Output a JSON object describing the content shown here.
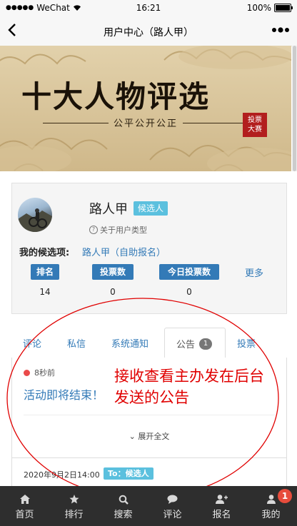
{
  "status_bar": {
    "carrier": "WeChat",
    "time": "16:21",
    "battery": "100%"
  },
  "nav": {
    "title": "用户中心（路人甲）"
  },
  "banner": {
    "title": "十大人物评选",
    "subtitle": "公平公开公正",
    "seal_line1": "投票",
    "seal_line2": "大赛"
  },
  "profile": {
    "name": "路人甲",
    "role_badge": "候选人",
    "user_type_link": "关于用户类型",
    "candidate_label": "我的候选项:",
    "candidate_value": "路人甲（自助报名）",
    "stats": [
      {
        "label": "排名",
        "value": "14"
      },
      {
        "label": "投票数",
        "value": "0"
      },
      {
        "label": "今日投票数",
        "value": "0"
      }
    ],
    "more_label": "更多"
  },
  "tabs": {
    "items": [
      "评论",
      "私信",
      "系统通知",
      "公告",
      "投票"
    ],
    "active_count": "1"
  },
  "notice": {
    "time": "8秒前",
    "message": "活动即将结束！",
    "expand_label": "展开全文",
    "date": "2020年9月2日14:00",
    "to_badge": "To：候选人"
  },
  "annotation": {
    "text": "接收查看主办发在后台发送的公告"
  },
  "tabbar": {
    "items": [
      {
        "label": "首页",
        "icon": "home-icon"
      },
      {
        "label": "排行",
        "icon": "star-icon"
      },
      {
        "label": "搜索",
        "icon": "search-icon"
      },
      {
        "label": "评论",
        "icon": "comment-icon"
      },
      {
        "label": "报名",
        "icon": "add-user-icon"
      },
      {
        "label": "我的",
        "icon": "user-icon"
      }
    ],
    "badge": "1"
  },
  "colors": {
    "link": "#337ab7",
    "info_badge": "#5bc0de",
    "annotation": "#e00000",
    "tabbar_bg": "#2e2e2e",
    "alert_badge": "#e74c3c"
  }
}
